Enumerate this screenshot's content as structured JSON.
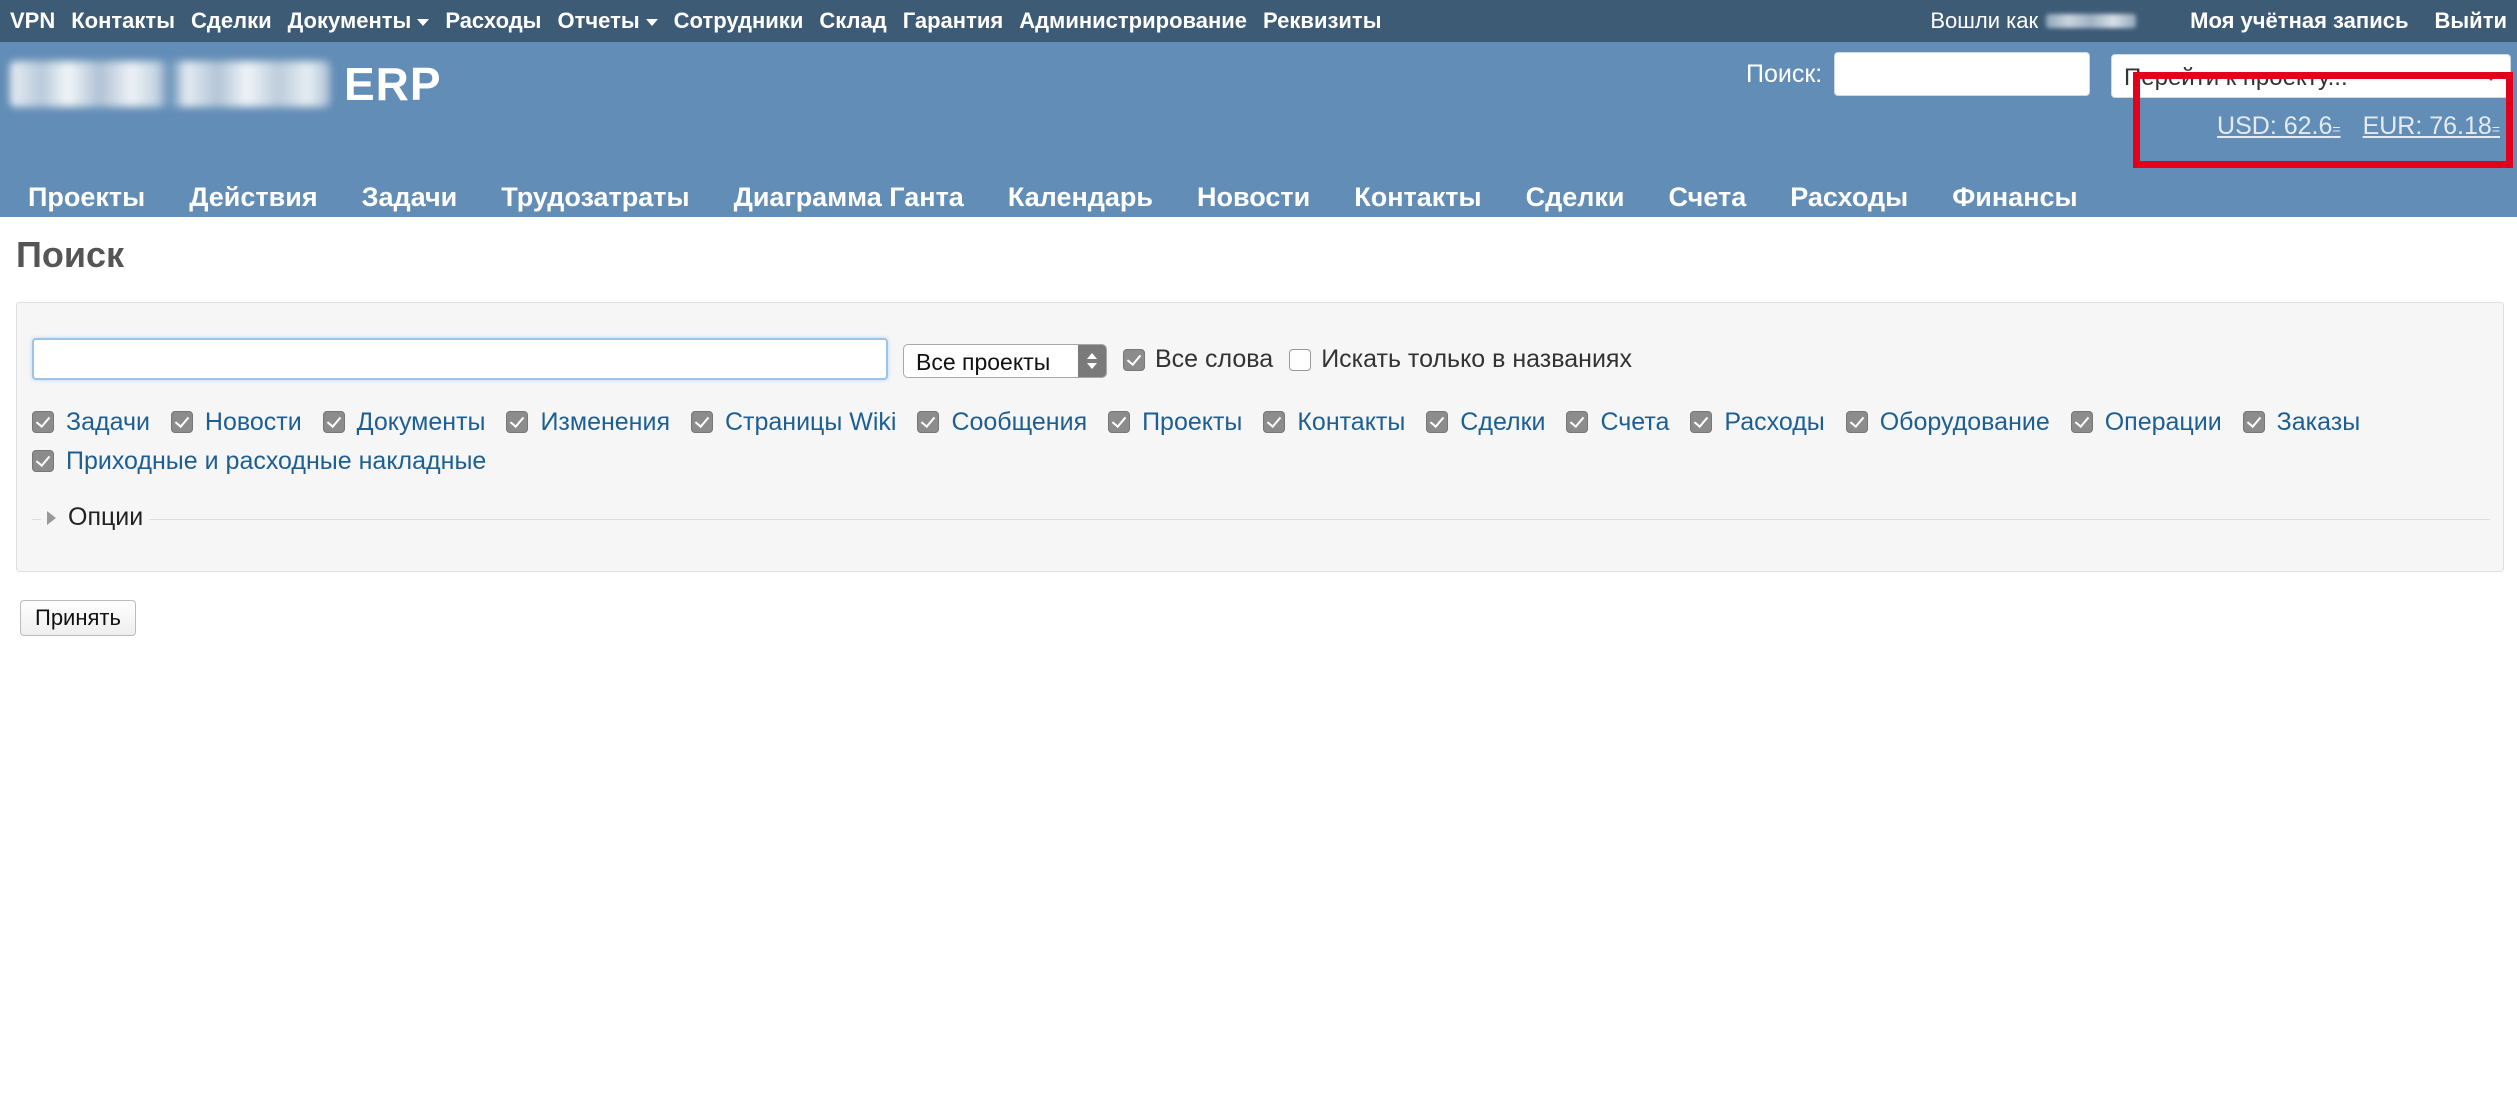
{
  "top_menu": {
    "items": [
      {
        "label": "VPN"
      },
      {
        "label": "Контакты"
      },
      {
        "label": "Сделки"
      },
      {
        "label": "Документы",
        "dropdown": true
      },
      {
        "label": "Расходы"
      },
      {
        "label": "Отчеты",
        "dropdown": true
      },
      {
        "label": "Сотрудники"
      },
      {
        "label": "Склад"
      },
      {
        "label": "Гарантия"
      },
      {
        "label": "Администрирование"
      },
      {
        "label": "Реквизиты"
      }
    ],
    "logged_as": "Вошли как",
    "my_account": "Моя учётная запись",
    "logout": "Выйти"
  },
  "header": {
    "logo_suffix": "ERP",
    "search_label": "Поиск:",
    "project_jump": "Перейти к проекту...",
    "rates": [
      {
        "label": "USD: 62.6",
        "suffix": "="
      },
      {
        "label": "EUR: 76.18",
        "suffix": "="
      }
    ]
  },
  "main_menu": {
    "items": [
      "Проекты",
      "Действия",
      "Задачи",
      "Трудозатраты",
      "Диаграмма Ганта",
      "Календарь",
      "Новости",
      "Контакты",
      "Сделки",
      "Счета",
      "Расходы",
      "Финансы"
    ]
  },
  "page": {
    "title": "Поиск",
    "query_value": "",
    "scope": "Все проекты",
    "all_words": "Все слова",
    "titles_only": "Искать только в названиях",
    "types": [
      "Задачи",
      "Новости",
      "Документы",
      "Изменения",
      "Страницы Wiki",
      "Сообщения",
      "Проекты",
      "Контакты",
      "Сделки",
      "Счета",
      "Расходы",
      "Оборудование",
      "Операции",
      "Заказы",
      "Приходные и расходные накладные"
    ],
    "options": "Опции",
    "submit": "Принять"
  },
  "colors": {
    "top_bar": "#3e5b76",
    "header": "#628db6",
    "link": "#1d5f94",
    "highlight_box": "#e3001b"
  }
}
